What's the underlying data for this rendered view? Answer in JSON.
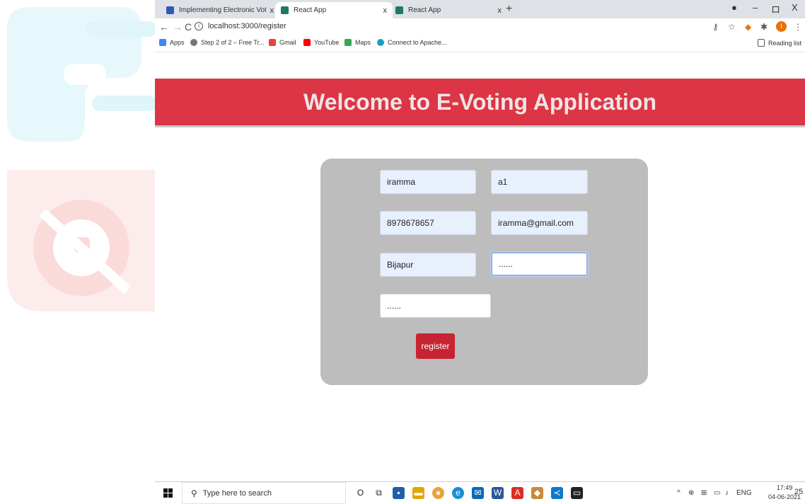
{
  "browser": {
    "tabs": [
      {
        "title": "Implementing Electronic Voting S",
        "active": false
      },
      {
        "title": "React App",
        "active": true
      },
      {
        "title": "React App",
        "active": false
      }
    ],
    "close_glyph": "x",
    "new_tab_glyph": "+",
    "window_controls": {
      "minimize": "–",
      "restore": "ロ",
      "close": "X"
    },
    "url": "localhost:3000/register",
    "bookmarks": [
      "Apps",
      "Step 2 of 2 – Free Tr...",
      "Gmail",
      "YouTube",
      "Maps",
      "Connect to Apache..."
    ],
    "reading_list": "Reading list"
  },
  "page": {
    "heading": "Welcome to E-Voting Application",
    "accent_color": "#dc3545",
    "form": {
      "fields": [
        {
          "name": "first-name-field",
          "value": "iramma",
          "type": "text"
        },
        {
          "name": "last-name-field",
          "value": "a1",
          "type": "text"
        },
        {
          "name": "phone-field",
          "value": "8978678657",
          "type": "text"
        },
        {
          "name": "email-field",
          "value": "iramma@gmail.com",
          "type": "text"
        },
        {
          "name": "city-field",
          "value": "Bijapur",
          "type": "text"
        },
        {
          "name": "password-field",
          "value": "......",
          "type": "password"
        },
        {
          "name": "confirm-password-field",
          "value": "......",
          "type": "password"
        }
      ],
      "submit_label": "register"
    }
  },
  "taskbar": {
    "search_placeholder": "Type here to search",
    "language": "ENG",
    "time": "17:49",
    "date": "04-06-2021",
    "notification_count": "25"
  }
}
